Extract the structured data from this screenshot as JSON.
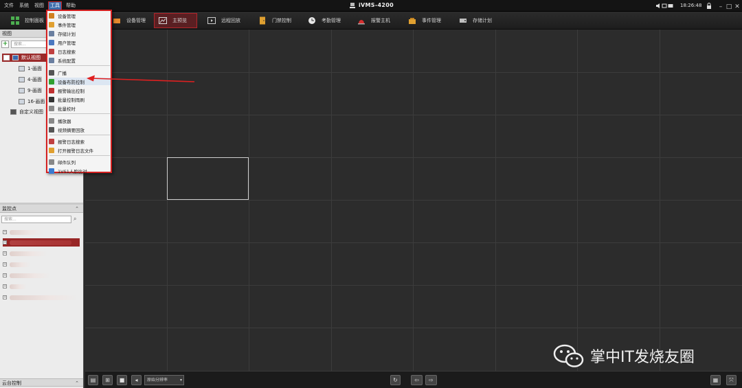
{
  "menubar": {
    "items": [
      "文件",
      "系统",
      "视图",
      "工具",
      "帮助"
    ],
    "active_index": 3
  },
  "app": {
    "title": "iVMS-4200"
  },
  "tray": {
    "time": "18:26:48"
  },
  "toolbar": {
    "items": [
      {
        "label": "控制面板",
        "icon": "dashboard-icon",
        "color": "#4caf50"
      },
      {
        "label": "设备管理",
        "icon": "device-icon",
        "color": "#e58a2d"
      },
      {
        "label": "主预览",
        "icon": "live-view-icon",
        "color": "#c0c0c0",
        "active": true
      },
      {
        "label": "远程回放",
        "icon": "playback-icon",
        "color": "#c0c0c0"
      },
      {
        "label": "门禁控制",
        "icon": "door-icon",
        "color": "#e0a030"
      },
      {
        "label": "考勤管理",
        "icon": "attendance-icon",
        "color": "#e8e8e8"
      },
      {
        "label": "报警主机",
        "icon": "alarm-host-icon",
        "color": "#d83030"
      },
      {
        "label": "事件管理",
        "icon": "event-icon",
        "color": "#e0a030"
      },
      {
        "label": "存储计划",
        "icon": "storage-icon",
        "color": "#c0c0c0"
      }
    ]
  },
  "view_panel": {
    "title": "视图",
    "search_placeholder": "搜索...",
    "default_view": "默认视图",
    "layouts": [
      "1-画面",
      "4-画面",
      "9-画面",
      "16-画面"
    ],
    "custom_view": "自定义视图"
  },
  "camera_panel": {
    "title": "监控点",
    "search_placeholder": "搜索..."
  },
  "ptz_panel": {
    "title": "云台控制"
  },
  "tools_menu": {
    "items": [
      {
        "label": "设备管理",
        "icon": "device-mgmt-icon",
        "color": "#d08020"
      },
      {
        "label": "事件管理",
        "icon": "event-mgmt-icon",
        "color": "#e0a030"
      },
      {
        "label": "存储计划",
        "icon": "storage-plan-icon",
        "color": "#6a7fa0"
      },
      {
        "label": "用户管理",
        "icon": "user-mgmt-icon",
        "color": "#4a78c0"
      },
      {
        "label": "日志搜索",
        "icon": "log-search-icon",
        "color": "#c04040"
      },
      {
        "label": "系统配置",
        "icon": "system-config-icon",
        "color": "#6a7fa0"
      },
      {
        "label": "广播",
        "icon": "broadcast-icon",
        "color": "#555555"
      },
      {
        "label": "设备布防控制",
        "icon": "arming-control-icon",
        "color": "#30a030"
      },
      {
        "label": "报警输出控制",
        "icon": "alarm-output-icon",
        "color": "#c03030"
      },
      {
        "label": "批量控制雨刷",
        "icon": "wiper-icon",
        "color": "#333333"
      },
      {
        "label": "批量校时",
        "icon": "time-sync-icon",
        "color": "#888888"
      },
      {
        "label": "播放器",
        "icon": "player-icon",
        "color": "#888888"
      },
      {
        "label": "视频摘要回放",
        "icon": "video-summary-icon",
        "color": "#555555"
      },
      {
        "label": "报警日志搜索",
        "icon": "alarm-log-icon",
        "color": "#c04040"
      },
      {
        "label": "打开报警日志文件",
        "icon": "open-log-file-icon",
        "color": "#e0a030"
      },
      {
        "label": "邮件队列",
        "icon": "mail-queue-icon",
        "color": "#888888"
      },
      {
        "label": "1VS1人脸比对",
        "icon": "face-compare-icon",
        "color": "#3a7ad0"
      }
    ],
    "highlight_index": 7
  },
  "bottombar": {
    "stream_select": "原始分辨率"
  },
  "watermark": {
    "text": "掌中IT发烧友圈"
  },
  "colors": {
    "accent_red": "#d42020",
    "selection_red": "#9a2a2a",
    "grid_bg": "#2c2c2c"
  }
}
